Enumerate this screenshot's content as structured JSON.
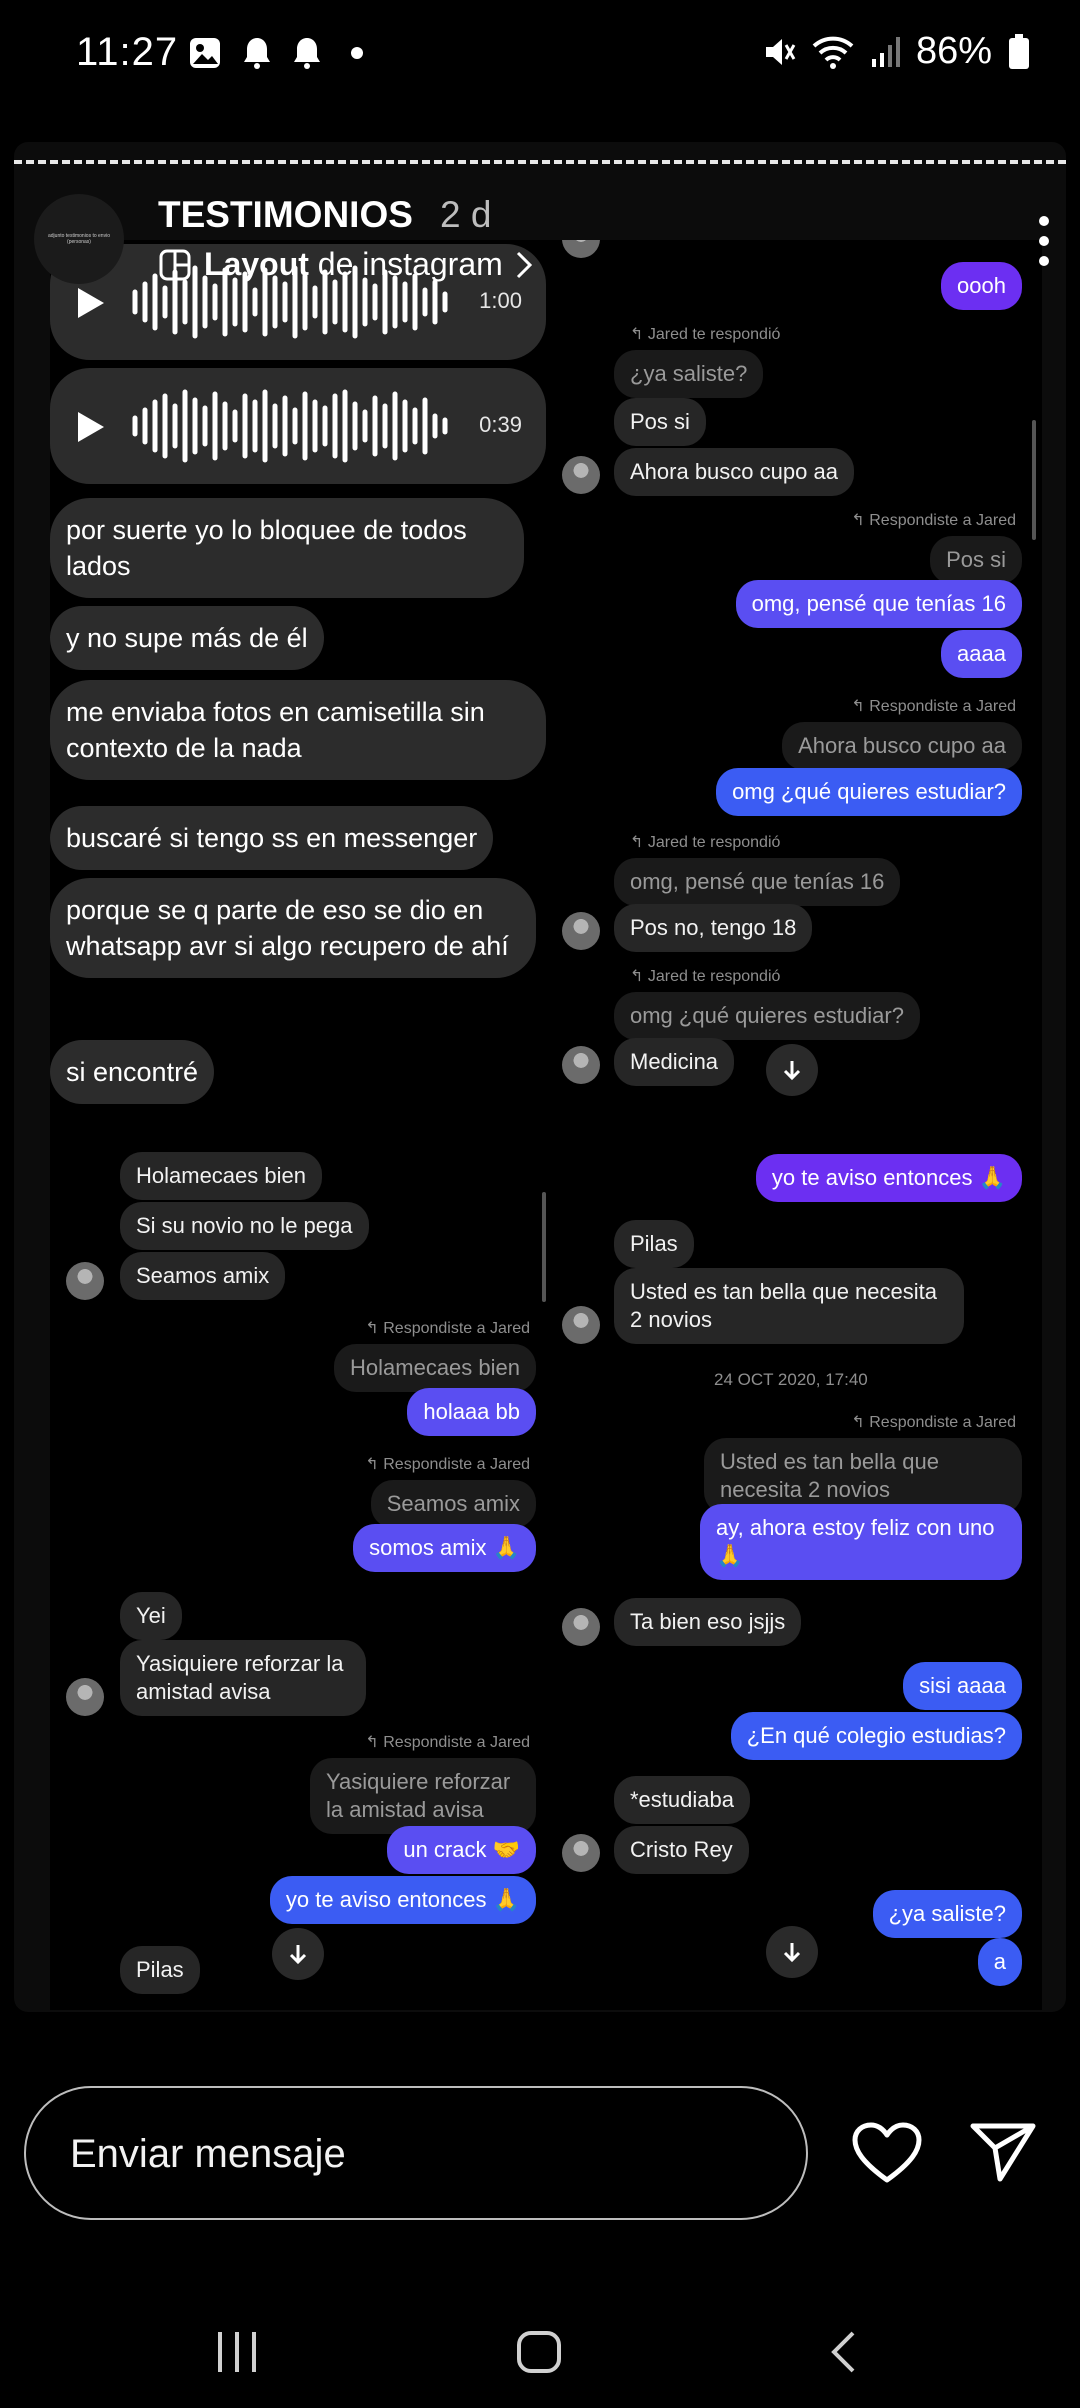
{
  "status": {
    "time": "11:27",
    "battery": "86%"
  },
  "story": {
    "name": "TESTIMONIOS",
    "age": "2 d",
    "layout_bold": "Layout",
    "layout_rest": " de instagram",
    "avatar_text": "adjunto testimonios to envio (personas)"
  },
  "panel1": {
    "audio1": "1:00",
    "audio2": "0:39",
    "msgs": [
      "por suerte yo lo bloquee de todos lados",
      "y no supe más de él",
      "me enviaba fotos en camisetilla sin contexto de la nada",
      "buscaré si tengo ss en messenger",
      "porque se q parte de eso se dio en whatsapp avr si algo recupero de ahí",
      "si encontré"
    ]
  },
  "panel2": {
    "oooh": "oooh",
    "jared_replied": "Jared te respondió",
    "q1": "¿ya saliste?",
    "a1": "Pos si",
    "a2": "Ahora busco cupo aa",
    "you_replied": "Respondiste a Jared",
    "q2": "Pos si",
    "m1": "omg, pensé que tenías 16",
    "m2": "aaaa",
    "q3": "Ahora busco cupo aa",
    "m3": "omg ¿qué quieres estudiar?",
    "q4": "omg, pensé que tenías 16",
    "a3": "Pos no, tengo 18",
    "q5": "omg ¿qué quieres estudiar?",
    "a4": "Medicina"
  },
  "panel3": {
    "g1": "Holamecaes bien",
    "g2": "Si su novio no le pega",
    "g3": "Seamos amix",
    "you_replied": "Respondiste a Jared",
    "q1": "Holamecaes bien",
    "m1": "holaaa bb",
    "q2": "Seamos amix",
    "m2": "somos amix 🙏",
    "g4": "Yei",
    "g5": "Yasiquiere reforzar la amistad avisa",
    "q3": "Yasiquiere reforzar la amistad avisa",
    "m3": "un crack 🤝",
    "m4": "yo te aviso entonces 🙏",
    "g6": "Pilas"
  },
  "panel4": {
    "m0": "yo te aviso entonces 🙏",
    "g1": "Pilas",
    "g2": "Usted es tan bella que necesita 2 novios",
    "date": "24 OCT 2020, 17:40",
    "you_replied": "Respondiste a Jared",
    "q1": "Usted es tan bella que necesita 2 novios",
    "m1": "ay, ahora estoy feliz con uno 🙏",
    "g3": "Ta bien eso jsjjs",
    "m2": "sisi aaaa",
    "m3": "¿En qué colegio estudias?",
    "g4": "*estudiaba",
    "g5": "Cristo Rey",
    "m4": "¿ya saliste?",
    "m5": "a"
  },
  "composer": {
    "placeholder": "Enviar mensaje"
  }
}
